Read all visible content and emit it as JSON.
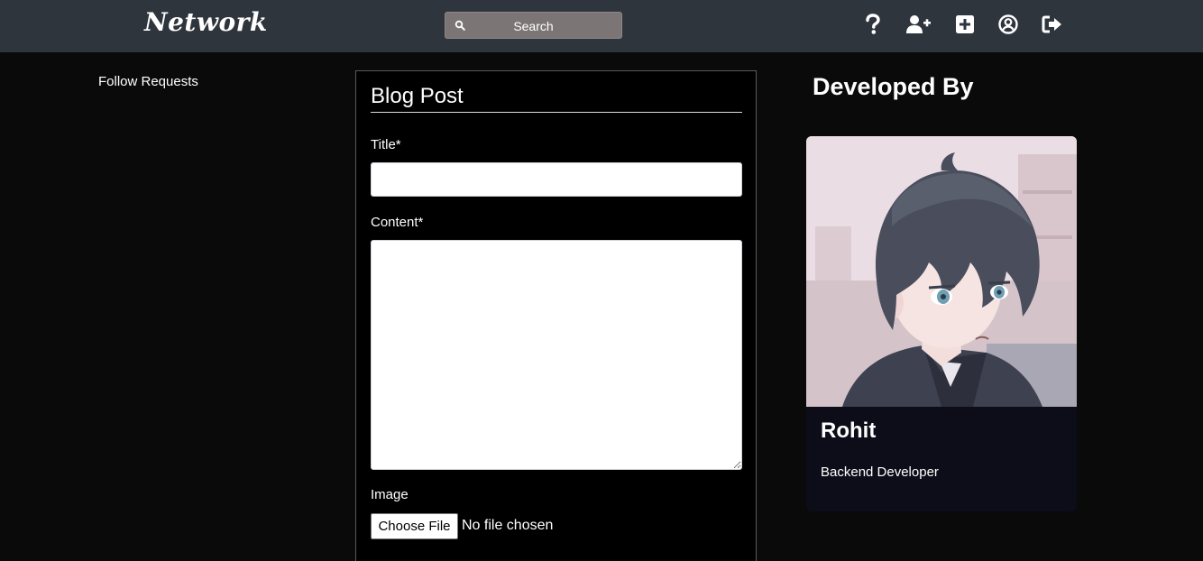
{
  "navbar": {
    "brand": "Network",
    "search_label": "Search",
    "icons": [
      "question-icon",
      "user-plus-icon",
      "plus-square-icon",
      "user-circle-icon",
      "sign-out-icon"
    ]
  },
  "sidebar": {
    "follow_requests": "Follow Requests"
  },
  "form": {
    "title": "Blog Post",
    "title_label": "Title*",
    "title_value": "",
    "content_label": "Content*",
    "content_value": "",
    "image_label": "Image",
    "file_button": "Choose File",
    "file_status": "No file chosen"
  },
  "developer": {
    "heading": "Developed By",
    "name": "Rohit",
    "role": "Backend Developer"
  },
  "colors": {
    "navbar_bg": "#2f353d",
    "page_bg": "#0a0a0a",
    "search_bg": "#7c7575",
    "card_bg": "#0c0d18"
  }
}
